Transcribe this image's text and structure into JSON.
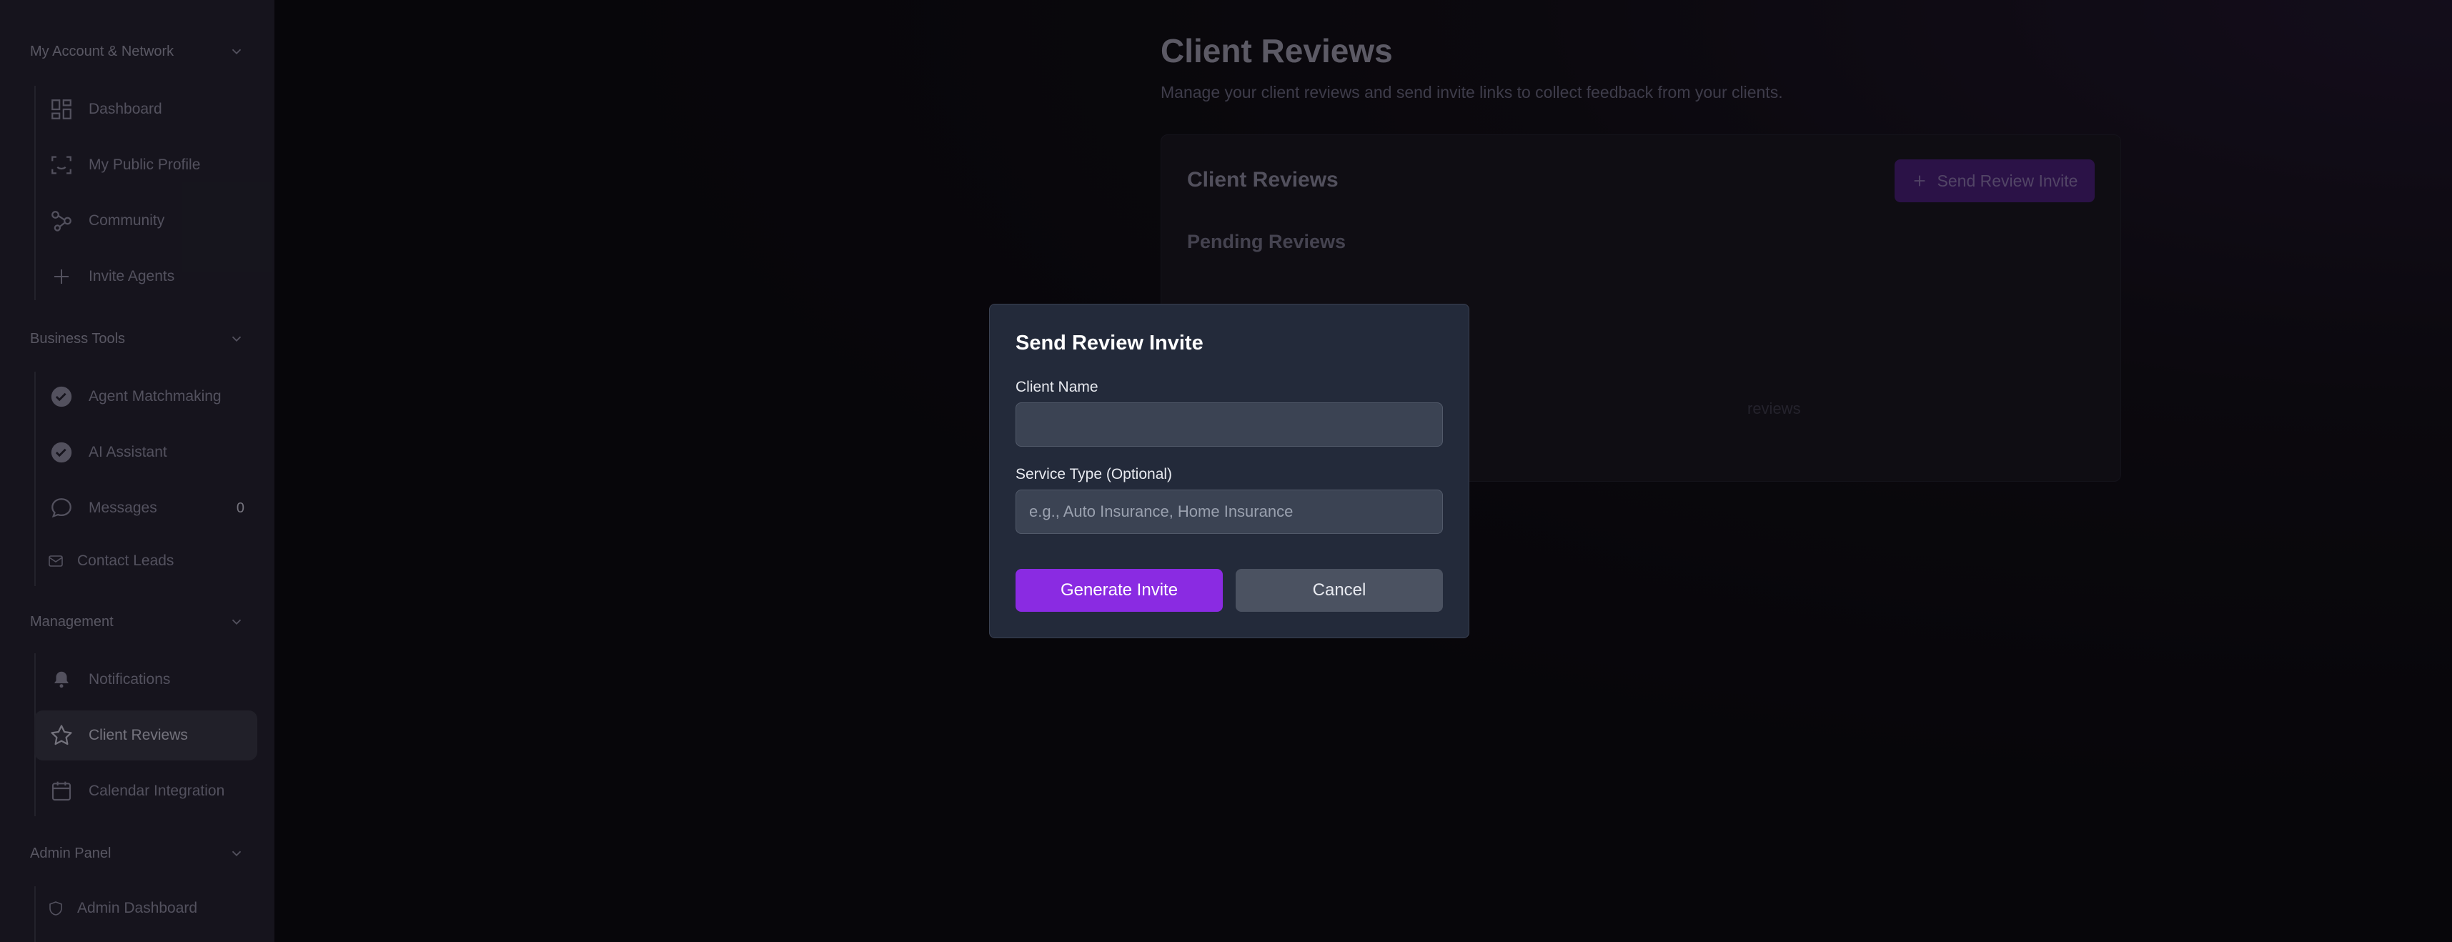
{
  "sidebar": {
    "sections": [
      {
        "title": "My Account & Network"
      },
      {
        "title": "Business Tools"
      },
      {
        "title": "Management"
      },
      {
        "title": "Admin Panel"
      }
    ],
    "items": [
      {
        "label": "Dashboard",
        "icon": "dashboard-icon"
      },
      {
        "label": "My Public Profile",
        "icon": "profile-scan-icon"
      },
      {
        "label": "Community",
        "icon": "community-icon"
      },
      {
        "label": "Invite Agents",
        "icon": "plus-icon"
      },
      {
        "label": "Agent Matchmaking",
        "icon": "check-circle-icon"
      },
      {
        "label": "AI Assistant",
        "icon": "check-circle-icon"
      },
      {
        "label": "Messages",
        "icon": "chat-icon",
        "badge": "0"
      },
      {
        "label": "Contact Leads",
        "icon": "mail-icon"
      },
      {
        "label": "Notifications",
        "icon": "bell-icon"
      },
      {
        "label": "Client Reviews",
        "icon": "star-icon",
        "active": true
      },
      {
        "label": "Calendar Integration",
        "icon": "calendar-icon"
      },
      {
        "label": "Admin Dashboard",
        "icon": "shield-icon"
      }
    ]
  },
  "main": {
    "title": "Client Reviews",
    "subtitle": "Manage your client reviews and send invite links to collect feedback from your clients.",
    "card": {
      "title": "Client Reviews",
      "invite_button": "Send Review Invite",
      "pending_title": "Pending Reviews",
      "empty_text": "reviews"
    }
  },
  "modal": {
    "title": "Send Review Invite",
    "client_name_label": "Client Name",
    "client_name_value": "",
    "service_type_label": "Service Type (Optional)",
    "service_type_placeholder": "e.g., Auto Insurance, Home Insurance",
    "generate_button": "Generate Invite",
    "cancel_button": "Cancel"
  },
  "colors": {
    "accent": "#8a2be2",
    "modal_bg": "#232a3a",
    "sidebar_bg": "#262432"
  }
}
